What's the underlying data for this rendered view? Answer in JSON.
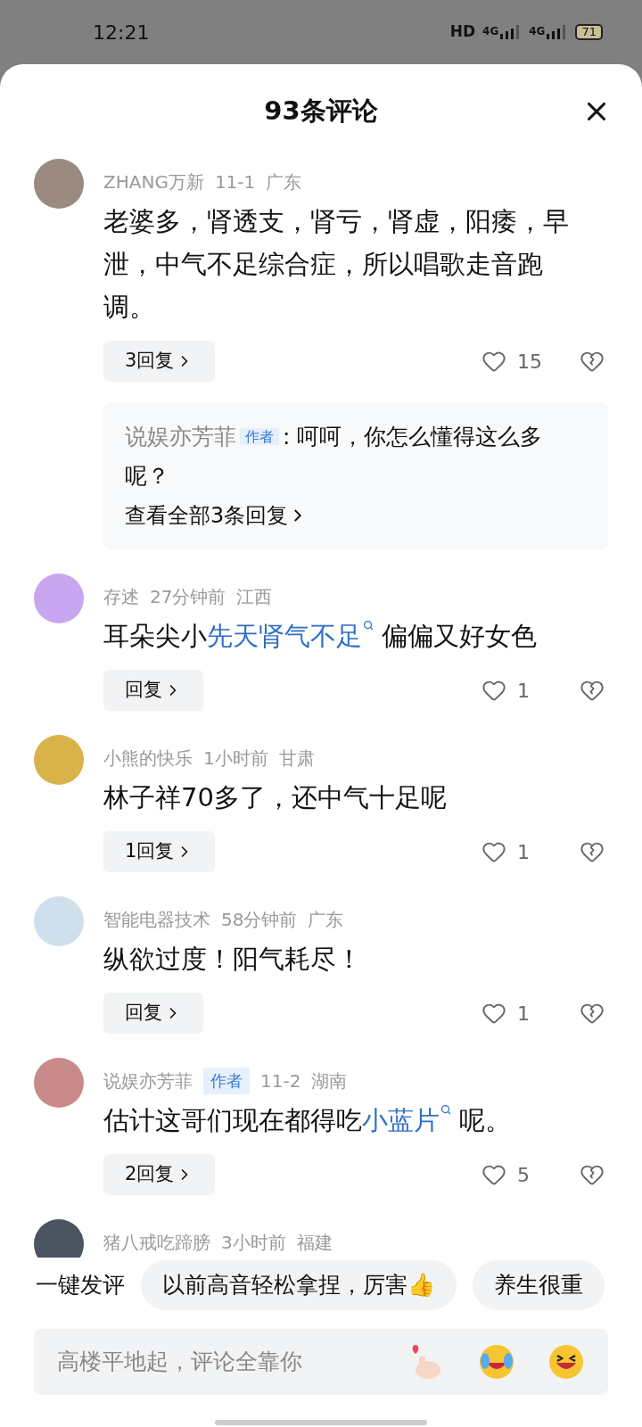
{
  "status_bar": {
    "time": "12:21",
    "hd": "HD",
    "networks": [
      "4G",
      "4G"
    ],
    "battery": "71"
  },
  "sheet": {
    "title": "93条评论"
  },
  "comments": [
    {
      "user": "ZHANG万新",
      "author": false,
      "time": "11-1",
      "location": "广东",
      "text": [
        {
          "kind": "plain",
          "text": "老婆多，肾透支，肾亏，肾虚，阳痿，早泄，中气不足综合症，所以唱歌走音跑调。"
        }
      ],
      "reply_button": "3回复",
      "likes": "15",
      "replies": {
        "user": "说娱亦芳菲",
        "badge": "作者",
        "text": ": 呵呵，你怎么懂得这么多呢？",
        "more": "查看全部3条回复"
      }
    },
    {
      "user": "存述",
      "author": false,
      "time": "27分钟前",
      "location": "江西",
      "text": [
        {
          "kind": "plain",
          "text": "耳朵尖小"
        },
        {
          "kind": "link",
          "text": "先天肾气不足"
        },
        {
          "kind": "plain",
          "text": " 偏偏又好女色"
        }
      ],
      "reply_button": "回复",
      "likes": "1"
    },
    {
      "user": "小熊的快乐",
      "author": false,
      "time": "1小时前",
      "location": "甘肃",
      "text": [
        {
          "kind": "plain",
          "text": "林子祥70多了，还中气十足呢"
        }
      ],
      "reply_button": "1回复",
      "likes": "1"
    },
    {
      "user": "智能电器技术",
      "author": false,
      "time": "58分钟前",
      "location": "广东",
      "text": [
        {
          "kind": "plain",
          "text": "纵欲过度！阳气耗尽！"
        }
      ],
      "reply_button": "回复",
      "likes": "1"
    },
    {
      "user": "说娱亦芳菲",
      "author": true,
      "author_label": "作者",
      "time": "11-2",
      "location": "湖南",
      "text": [
        {
          "kind": "plain",
          "text": "估计这哥们现在都得吃"
        },
        {
          "kind": "link",
          "text": "小蓝片"
        },
        {
          "kind": "plain",
          "text": " 呢。"
        }
      ],
      "reply_button": "2回复",
      "likes": "5"
    },
    {
      "user": "猪八戒吃蹄膀",
      "author": false,
      "time": "3小时前",
      "location": "福建"
    }
  ],
  "quick_comment": {
    "label": "一键发评",
    "chips": [
      "以前高音轻松拿捏，厉害👍",
      "养生很重"
    ]
  },
  "input": {
    "placeholder": "高楼平地起，评论全靠你"
  }
}
